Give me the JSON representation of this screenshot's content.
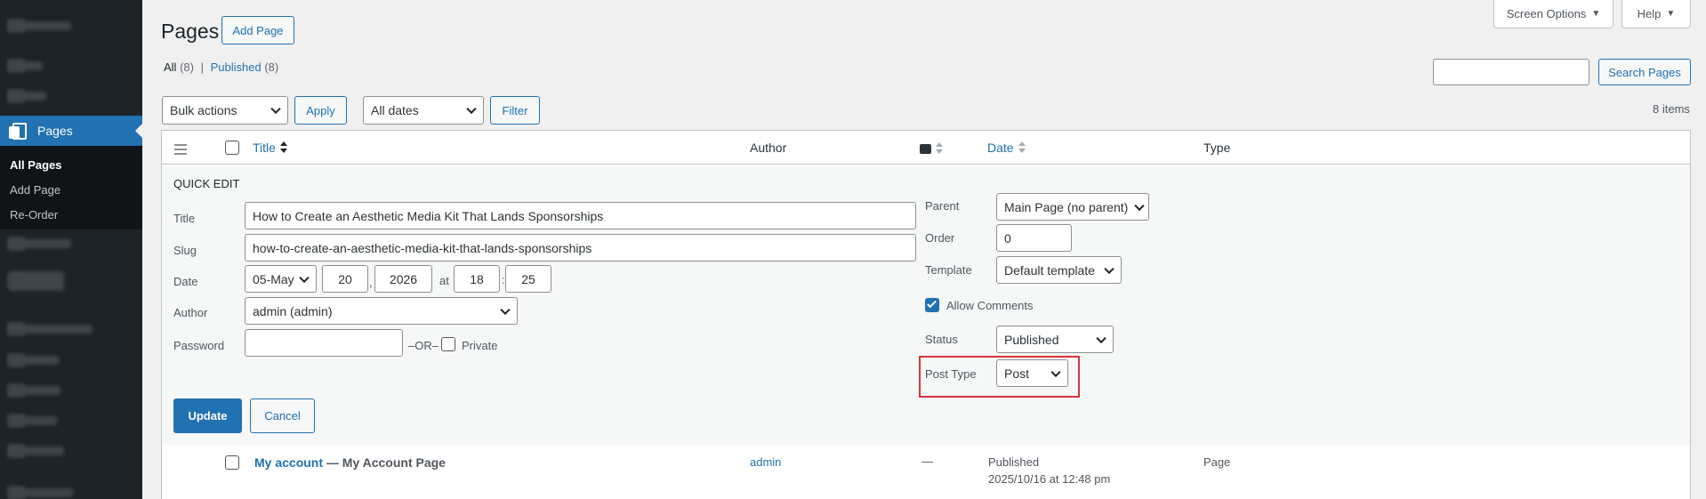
{
  "sidebar": {
    "pages_label": "Pages",
    "submenu": [
      "All Pages",
      "Add Page",
      "Re-Order"
    ]
  },
  "header": {
    "title": "Pages",
    "add_page": "Add Page",
    "screen_options": "Screen Options",
    "help": "Help"
  },
  "filters": {
    "all_label": "All",
    "all_count": "(8)",
    "published_label": "Published",
    "published_count": "(8)",
    "separator": "|",
    "search_button": "Search Pages",
    "bulk_actions": "Bulk actions",
    "apply": "Apply",
    "dates": "All dates",
    "filter": "Filter",
    "items_count": "8 items"
  },
  "table": {
    "col_title": "Title",
    "col_author": "Author",
    "col_date": "Date",
    "col_type": "Type"
  },
  "quick_edit": {
    "heading": "QUICK EDIT",
    "title_label": "Title",
    "title_value": "How to Create an Aesthetic Media Kit That Lands Sponsorships",
    "slug_label": "Slug",
    "slug_value": "how-to-create-an-aesthetic-media-kit-that-lands-sponsorships",
    "date_label": "Date",
    "month": "05-May",
    "day": "20",
    "comma": ",",
    "year": "2026",
    "at": "at",
    "hour": "18",
    "colon": ":",
    "minute": "25",
    "author_label": "Author",
    "author_value": "admin (admin)",
    "password_label": "Password",
    "password_value": "",
    "or": "–OR–",
    "private": "Private",
    "parent_label": "Parent",
    "parent_value": "Main Page (no parent)",
    "order_label": "Order",
    "order_value": "0",
    "template_label": "Template",
    "template_value": "Default template",
    "allow_comments": "Allow Comments",
    "allow_comments_checked": true,
    "status_label": "Status",
    "status_value": "Published",
    "post_type_label": "Post Type",
    "post_type_value": "Post",
    "update": "Update",
    "cancel": "Cancel"
  },
  "rows": [
    {
      "title": "My account",
      "state": " — My Account Page",
      "author": "admin",
      "comments": "—",
      "date_status": "Published",
      "date_value": "2025/10/16 at 12:48 pm",
      "type": "Page"
    }
  ],
  "colors": {
    "accent": "#2271b1",
    "sidebar": "#1d2327",
    "highlight": "#d63638"
  }
}
